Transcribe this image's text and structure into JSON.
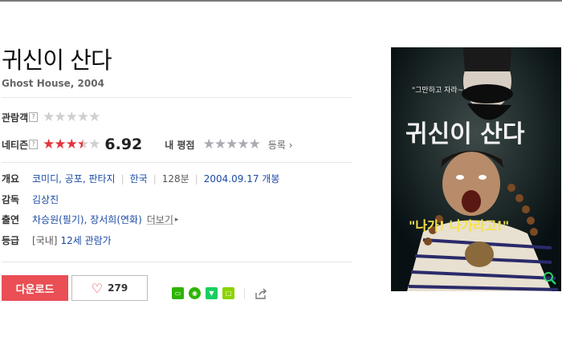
{
  "movie": {
    "title": "귀신이 산다",
    "subtitle": "Ghost House, 2004"
  },
  "ratings": {
    "audience_label": "관람객",
    "help_glyph": "?",
    "audience_stars": 0,
    "netizen_label": "네티즌",
    "netizen_score": "6.92",
    "netizen_stars": 3.5,
    "my_rating_label": "내 평점",
    "my_stars": 0,
    "register_label": "등록"
  },
  "info": {
    "overview_label": "개요",
    "genres": "코미디, 공포, 판타지",
    "country": "한국",
    "runtime": "128분",
    "release": "2004.09.17 개봉",
    "director_label": "감독",
    "director": "김상진",
    "cast_label": "출연",
    "cast": "차승원(필기), 장서희(연화)",
    "more_label": "더보기",
    "grade_label": "등급",
    "grade_prefix": "[국내]",
    "grade": "12세 관람가"
  },
  "actions": {
    "download_label": "다운로드",
    "like_count": "279"
  },
  "colors": {
    "accent_red": "#e94f55",
    "link_blue": "#1b4aa5"
  },
  "poster": {
    "title_text": "귀신이 산다",
    "quote_text": "\"그만하고 자라~\"",
    "exclaim_text": "\"나가! 나가라고!\""
  }
}
